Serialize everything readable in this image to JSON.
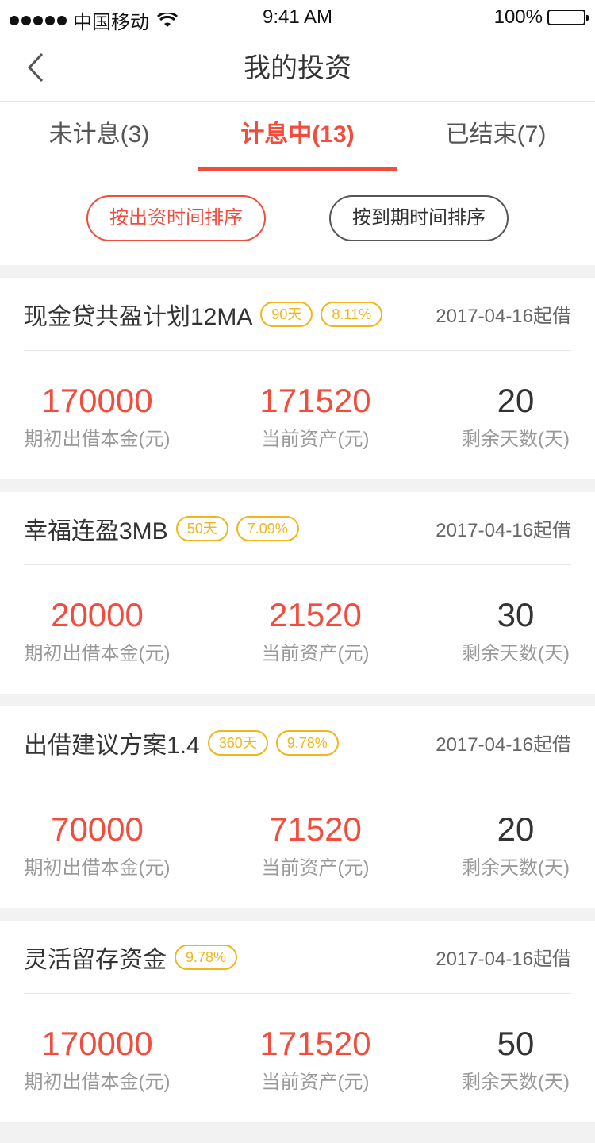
{
  "status_bar": {
    "carrier": "中国移动",
    "time": "9:41 AM",
    "battery": "100%"
  },
  "nav": {
    "title": "我的投资",
    "back_icon": "chevron-left-icon"
  },
  "tabs": [
    {
      "label": "未计息(3)",
      "active": false
    },
    {
      "label": "计息中(13)",
      "active": true
    },
    {
      "label": "已结束(7)",
      "active": false
    }
  ],
  "sort": {
    "by_invest_time": "按出资时间排序",
    "by_due_time": "按到期时间排序"
  },
  "labels": {
    "principal": "期初出借本金(元)",
    "current_assets": "当前资产(元)",
    "days_left": "剩余天数(天)"
  },
  "colors": {
    "accent": "#f24c3d",
    "tag": "#f2b51a"
  },
  "cards": [
    {
      "title": "现金贷共盈计划12MA",
      "tags": [
        "90天",
        "8.11%"
      ],
      "date": "2017-04-16起借",
      "principal": "170000",
      "current": "171520",
      "days": "20"
    },
    {
      "title": "幸福连盈3MB",
      "tags": [
        "50天",
        "7.09%"
      ],
      "date": "2017-04-16起借",
      "principal": "20000",
      "current": "21520",
      "days": "30"
    },
    {
      "title": "出借建议方案1.4",
      "tags": [
        "360天",
        "9.78%"
      ],
      "date": "2017-04-16起借",
      "principal": "70000",
      "current": "71520",
      "days": "20"
    },
    {
      "title": "灵活留存资金",
      "tags": [
        "9.78%"
      ],
      "date": "2017-04-16起借",
      "principal": "170000",
      "current": "171520",
      "days": "50"
    }
  ]
}
